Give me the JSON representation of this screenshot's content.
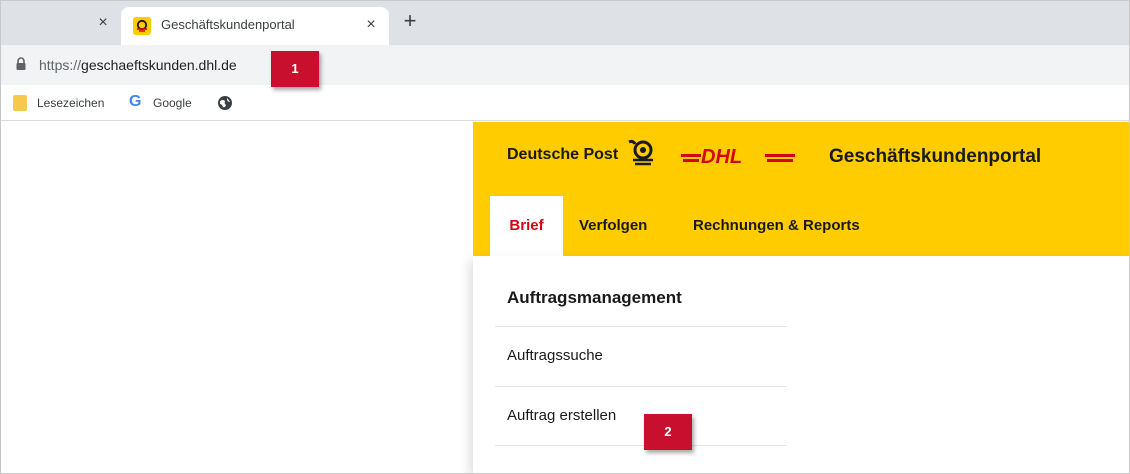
{
  "browser": {
    "tabs": [
      {
        "title": "Geschäftskundenportal",
        "active": true,
        "favicon": "posthorn-icon"
      }
    ],
    "prev_tab_close": "×",
    "active_tab_close": "×",
    "new_tab": "+",
    "url_scheme": "https://",
    "url_host": "geschaeftskunden.dhl.de",
    "bookmarks": [
      {
        "label": "Lesezeichen",
        "icon": "folder-icon"
      },
      {
        "label": "Google",
        "icon": "google-icon"
      },
      {
        "label": "",
        "icon": "globe-icon"
      }
    ],
    "google_glyph": "G"
  },
  "portal": {
    "brand_text": "Deutsche Post",
    "dhl_logo_text": "DHL",
    "title": "Geschäftskundenportal",
    "nav": [
      {
        "label": "Brief",
        "active": true
      },
      {
        "label": "Verfolgen",
        "active": false
      },
      {
        "label": "Rechnungen & Reports",
        "active": false
      }
    ],
    "menu": {
      "heading": "Auftragsmanagement",
      "items": [
        "Auftragssuche",
        "Auftrag erstellen"
      ]
    }
  },
  "markers": [
    "1",
    "2"
  ],
  "colors": {
    "dhl_yellow": "#ffcc00",
    "dhl_red": "#d40511",
    "marker_red": "#c8102e"
  }
}
